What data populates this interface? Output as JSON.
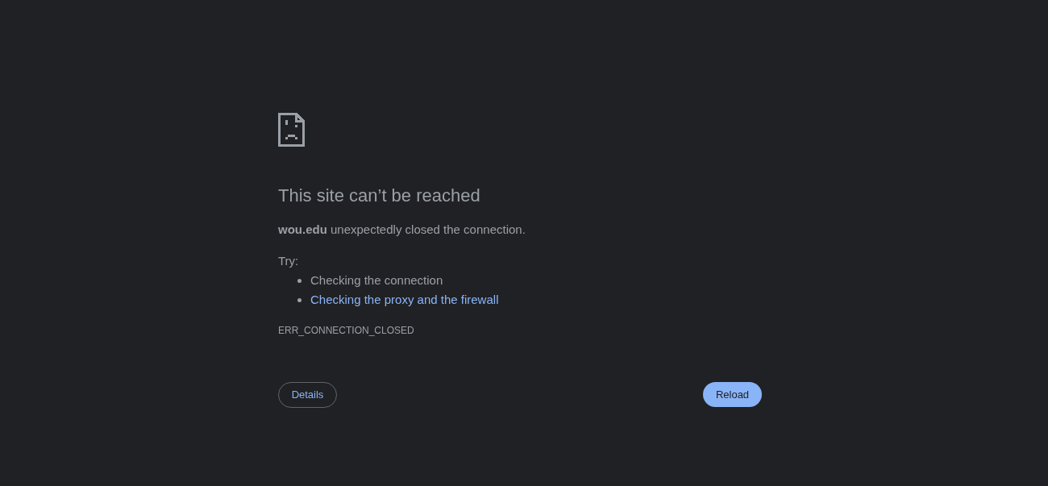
{
  "heading": "This site can’t be reached",
  "message": "**wou.edu** unexpectedly closed the connection.",
  "suggestions_label": "Try:",
  "suggestions": [
    {
      "kind": "text",
      "text": "Checking the connection"
    },
    {
      "kind": "link",
      "text": "Checking the proxy and the firewall"
    }
  ],
  "error_code": "ERR_CONNECTION_CLOSED",
  "buttons": [
    {
      "kind": "outline",
      "label": "Details"
    },
    {
      "kind": "filled",
      "label": "Reload"
    }
  ]
}
